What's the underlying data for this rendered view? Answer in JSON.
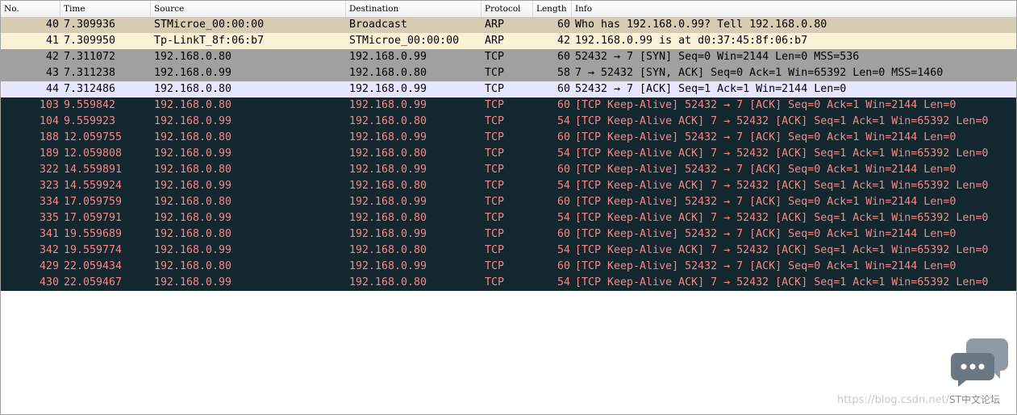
{
  "columns": [
    "No.",
    "Time",
    "Source",
    "Destination",
    "Protocol",
    "Length",
    "Info"
  ],
  "colors": {
    "arp_bg": "#d6cbb3",
    "arp_reply_bg": "#fbf1d6",
    "syn_bg": "#a0a0a0",
    "ack_bg": "#e7e6ff",
    "ka_bg": "#12272e",
    "dark_fg": "#000000",
    "ka_fg": "#f78787"
  },
  "packets": [
    {
      "no": "40",
      "time": "7.309936",
      "source": "STMicroe_00:00:00",
      "destination": "Broadcast",
      "protocol": "ARP",
      "length": "60",
      "info": "Who has 192.168.0.99? Tell 192.168.0.80",
      "bg": "#d6cbb3",
      "fg": "#000000"
    },
    {
      "no": "41",
      "time": "7.309950",
      "source": "Tp-LinkT_8f:06:b7",
      "destination": "STMicroe_00:00:00",
      "protocol": "ARP",
      "length": "42",
      "info": "192.168.0.99 is at d0:37:45:8f:06:b7",
      "bg": "#fbf1d6",
      "fg": "#000000"
    },
    {
      "no": "42",
      "time": "7.311072",
      "source": "192.168.0.80",
      "destination": "192.168.0.99",
      "protocol": "TCP",
      "length": "60",
      "info": "52432 → 7 [SYN] Seq=0 Win=2144 Len=0 MSS=536",
      "bg": "#a0a0a0",
      "fg": "#000000"
    },
    {
      "no": "43",
      "time": "7.311238",
      "source": "192.168.0.99",
      "destination": "192.168.0.80",
      "protocol": "TCP",
      "length": "58",
      "info": "7 → 52432 [SYN, ACK] Seq=0 Ack=1 Win=65392 Len=0 MSS=1460",
      "bg": "#a0a0a0",
      "fg": "#000000"
    },
    {
      "no": "44",
      "time": "7.312486",
      "source": "192.168.0.80",
      "destination": "192.168.0.99",
      "protocol": "TCP",
      "length": "60",
      "info": "52432 → 7 [ACK] Seq=1 Ack=1 Win=2144 Len=0",
      "bg": "#e7e6ff",
      "fg": "#000000"
    },
    {
      "no": "103",
      "time": "9.559842",
      "source": "192.168.0.80",
      "destination": "192.168.0.99",
      "protocol": "TCP",
      "length": "60",
      "info": "[TCP Keep-Alive] 52432 → 7 [ACK] Seq=0 Ack=1 Win=2144 Len=0",
      "bg": "#12272e",
      "fg": "#f78787"
    },
    {
      "no": "104",
      "time": "9.559923",
      "source": "192.168.0.99",
      "destination": "192.168.0.80",
      "protocol": "TCP",
      "length": "54",
      "info": "[TCP Keep-Alive ACK] 7 → 52432 [ACK] Seq=1 Ack=1 Win=65392 Len=0",
      "bg": "#12272e",
      "fg": "#f78787"
    },
    {
      "no": "188",
      "time": "12.059755",
      "source": "192.168.0.80",
      "destination": "192.168.0.99",
      "protocol": "TCP",
      "length": "60",
      "info": "[TCP Keep-Alive] 52432 → 7 [ACK] Seq=0 Ack=1 Win=2144 Len=0",
      "bg": "#12272e",
      "fg": "#f78787"
    },
    {
      "no": "189",
      "time": "12.059808",
      "source": "192.168.0.99",
      "destination": "192.168.0.80",
      "protocol": "TCP",
      "length": "54",
      "info": "[TCP Keep-Alive ACK] 7 → 52432 [ACK] Seq=1 Ack=1 Win=65392 Len=0",
      "bg": "#12272e",
      "fg": "#f78787"
    },
    {
      "no": "322",
      "time": "14.559891",
      "source": "192.168.0.80",
      "destination": "192.168.0.99",
      "protocol": "TCP",
      "length": "60",
      "info": "[TCP Keep-Alive] 52432 → 7 [ACK] Seq=0 Ack=1 Win=2144 Len=0",
      "bg": "#12272e",
      "fg": "#f78787"
    },
    {
      "no": "323",
      "time": "14.559924",
      "source": "192.168.0.99",
      "destination": "192.168.0.80",
      "protocol": "TCP",
      "length": "54",
      "info": "[TCP Keep-Alive ACK] 7 → 52432 [ACK] Seq=1 Ack=1 Win=65392 Len=0",
      "bg": "#12272e",
      "fg": "#f78787"
    },
    {
      "no": "334",
      "time": "17.059759",
      "source": "192.168.0.80",
      "destination": "192.168.0.99",
      "protocol": "TCP",
      "length": "60",
      "info": "[TCP Keep-Alive] 52432 → 7 [ACK] Seq=0 Ack=1 Win=2144 Len=0",
      "bg": "#12272e",
      "fg": "#f78787"
    },
    {
      "no": "335",
      "time": "17.059791",
      "source": "192.168.0.99",
      "destination": "192.168.0.80",
      "protocol": "TCP",
      "length": "54",
      "info": "[TCP Keep-Alive ACK] 7 → 52432 [ACK] Seq=1 Ack=1 Win=65392 Len=0",
      "bg": "#12272e",
      "fg": "#f78787"
    },
    {
      "no": "341",
      "time": "19.559689",
      "source": "192.168.0.80",
      "destination": "192.168.0.99",
      "protocol": "TCP",
      "length": "60",
      "info": "[TCP Keep-Alive] 52432 → 7 [ACK] Seq=0 Ack=1 Win=2144 Len=0",
      "bg": "#12272e",
      "fg": "#f78787"
    },
    {
      "no": "342",
      "time": "19.559774",
      "source": "192.168.0.99",
      "destination": "192.168.0.80",
      "protocol": "TCP",
      "length": "54",
      "info": "[TCP Keep-Alive ACK] 7 → 52432 [ACK] Seq=1 Ack=1 Win=65392 Len=0",
      "bg": "#12272e",
      "fg": "#f78787"
    },
    {
      "no": "429",
      "time": "22.059434",
      "source": "192.168.0.80",
      "destination": "192.168.0.99",
      "protocol": "TCP",
      "length": "60",
      "info": "[TCP Keep-Alive] 52432 → 7 [ACK] Seq=0 Ack=1 Win=2144 Len=0",
      "bg": "#12272e",
      "fg": "#f78787"
    },
    {
      "no": "430",
      "time": "22.059467",
      "source": "192.168.0.99",
      "destination": "192.168.0.80",
      "protocol": "TCP",
      "length": "54",
      "info": "[TCP Keep-Alive ACK] 7 → 52432 [ACK] Seq=1 Ack=1 Win=65392 Len=0",
      "bg": "#12272e",
      "fg": "#f78787"
    }
  ],
  "watermark": {
    "icon": "chat-bubbles-icon",
    "url": "https://blog.csdn.net/",
    "brand": "ST中文论坛"
  }
}
